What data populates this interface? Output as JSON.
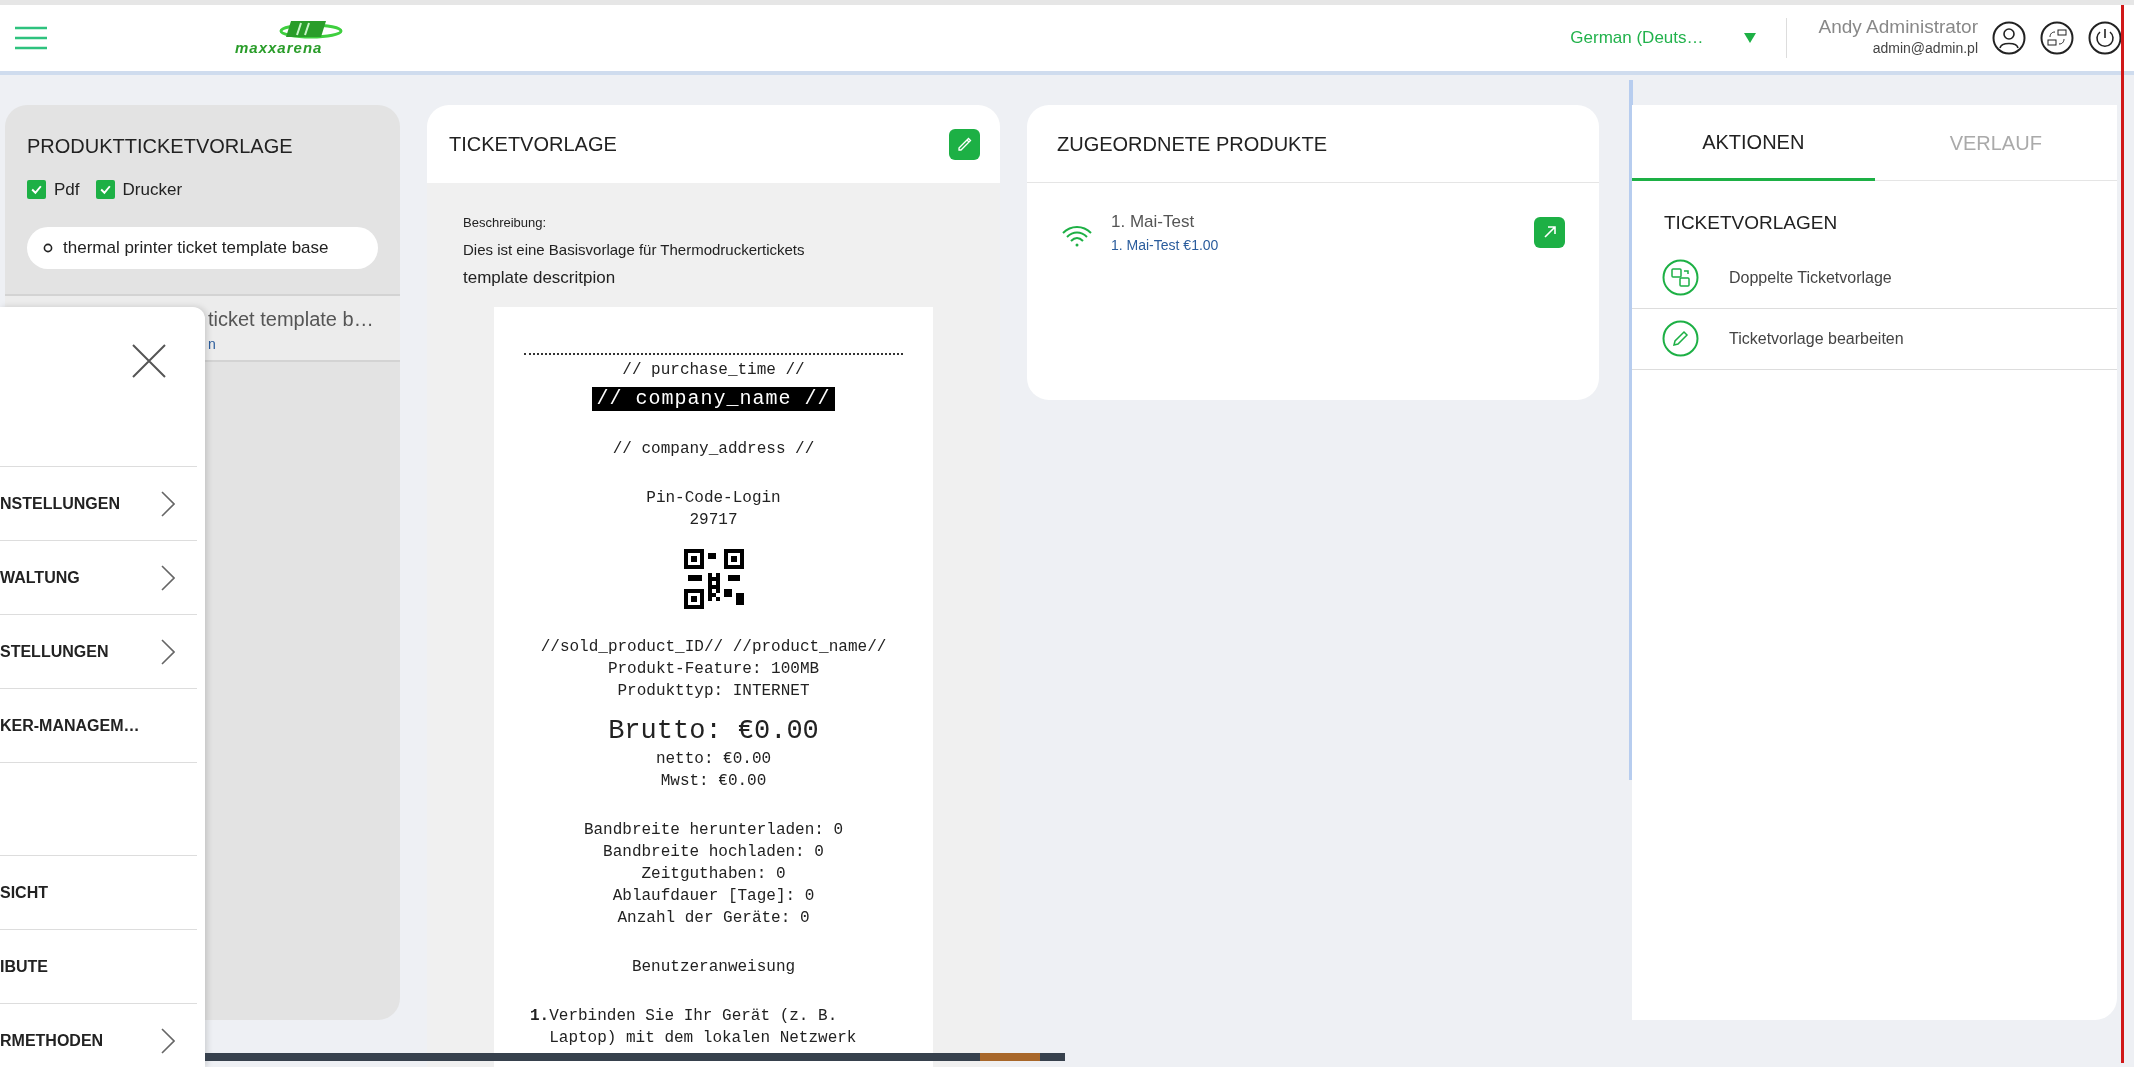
{
  "header": {
    "logo_text": "maxxarena",
    "language": "German (Deuts…",
    "user_name": "Andy Administrator",
    "user_email": "admin@admin.pl"
  },
  "left_panel": {
    "title": "PRODUKTTICKETVORLAGE",
    "filters": [
      {
        "label": "Pdf",
        "checked": true
      },
      {
        "label": "Drucker",
        "checked": true
      }
    ],
    "search": {
      "value": "thermal printer ticket template base"
    },
    "items": [
      {
        "title": "ticket template b…",
        "subtitle": "n"
      }
    ]
  },
  "drawer": {
    "items": [
      {
        "kind": "link",
        "label": "NSTELLUNGEN",
        "submenu": true
      },
      {
        "kind": "link",
        "label": "WALTUNG",
        "submenu": true
      },
      {
        "kind": "link",
        "label": "STELLUNGEN",
        "submenu": true
      },
      {
        "kind": "link",
        "label": "KER-MANAGEM…",
        "submenu": false
      },
      {
        "kind": "blank"
      },
      {
        "kind": "link",
        "label": "SICHT",
        "submenu": false
      },
      {
        "kind": "link",
        "label": "IBUTE",
        "submenu": false
      },
      {
        "kind": "link",
        "label": "RMETHODEN",
        "submenu": true
      }
    ]
  },
  "ticket_template": {
    "title": "TICKETVORLAGE",
    "description_label": "Beschreibung:",
    "description": "Dies ist eine Basisvorlage für Thermodruckertickets",
    "description_note": "template descritpion",
    "receipt": [
      [
        {
          "kind": "dots"
        },
        {
          "kind": "text",
          "text": "// purchase_time //"
        },
        {
          "kind": "inverse",
          "text": "// company_name //"
        }
      ],
      [
        {
          "kind": "text",
          "text": "// company_address //"
        }
      ],
      [
        {
          "kind": "text",
          "text": "Pin-Code-Login"
        },
        {
          "kind": "text",
          "text": "29717"
        },
        {
          "kind": "qr"
        }
      ],
      [
        {
          "kind": "text",
          "text": "//sold_product_ID// //product_name//"
        },
        {
          "kind": "text",
          "text": "Produkt-Feature: 100MB"
        },
        {
          "kind": "text",
          "text": "Produkttyp: INTERNET"
        },
        {
          "kind": "large",
          "text": "Brutto: €0.00"
        },
        {
          "kind": "text",
          "text": "netto: €0.00"
        },
        {
          "kind": "text",
          "text": "Mwst: €0.00"
        }
      ],
      [
        {
          "kind": "text",
          "text": "Bandbreite herunterladen: 0"
        },
        {
          "kind": "text",
          "text": "Bandbreite hochladen: 0"
        },
        {
          "kind": "text",
          "text": "Zeitguthaben: 0"
        },
        {
          "kind": "text",
          "text": "Ablaufdauer [Tage]: 0"
        },
        {
          "kind": "text",
          "text": "Anzahl der Geräte: 0"
        }
      ],
      [
        {
          "kind": "text",
          "text": "Benutzeranweisung"
        }
      ],
      [
        {
          "kind": "step",
          "text": "**1.**Verbinden Sie Ihr Gerät (z. B. Laptop) mit dem lokalen Netzwerk"
        }
      ]
    ]
  },
  "products": {
    "title": "ZUGEORDNETE PRODUKTE",
    "items": [
      {
        "name": "1. Mai-Test",
        "detail": "1. Mai-Test €1.00"
      }
    ]
  },
  "actions_panel": {
    "tabs": [
      {
        "label": "AKTIONEN",
        "selected": true
      },
      {
        "label": "VERLAUF",
        "selected": false
      }
    ],
    "section_title": "TICKETVORLAGEN",
    "actions": [
      {
        "kind": "duplicate",
        "label": "Doppelte Ticketvorlage"
      },
      {
        "kind": "edit",
        "label": "Ticketvorlage bearbeiten"
      }
    ]
  }
}
